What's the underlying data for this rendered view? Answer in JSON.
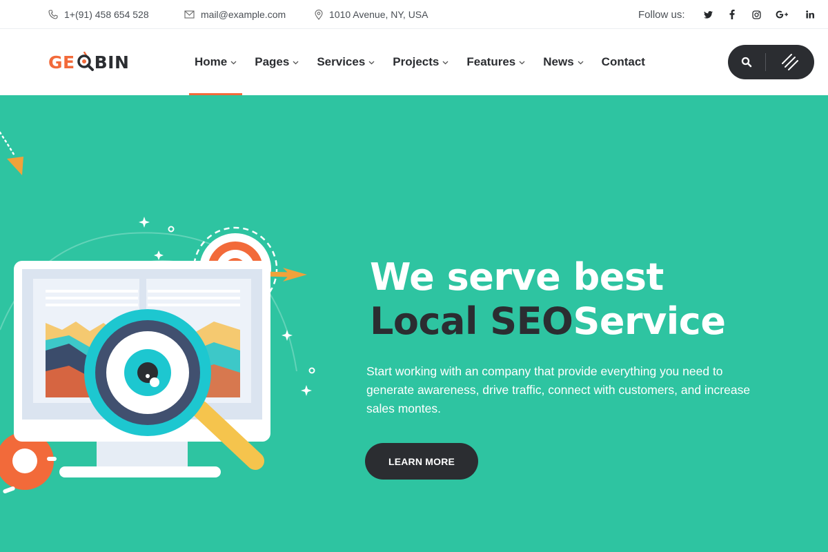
{
  "topbar": {
    "phone": "1+(91) 458 654 528",
    "email": "mail@example.com",
    "address": "1010 Avenue, NY, USA",
    "follow_label": "Follow us:",
    "social": [
      {
        "icon": "twitter-icon",
        "glyph": "t"
      },
      {
        "icon": "facebook-icon",
        "glyph": "f"
      },
      {
        "icon": "instagram-icon",
        "glyph": "o"
      },
      {
        "icon": "google-plus-icon",
        "glyph": "G+"
      },
      {
        "icon": "linkedin-icon",
        "glyph": "in"
      }
    ]
  },
  "header": {
    "logo": {
      "part1": "GE",
      "part2": "BIN"
    },
    "nav": [
      {
        "label": "Home",
        "has_dropdown": true,
        "active": true
      },
      {
        "label": "Pages",
        "has_dropdown": true
      },
      {
        "label": "Services",
        "has_dropdown": true
      },
      {
        "label": "Projects",
        "has_dropdown": true
      },
      {
        "label": "Features",
        "has_dropdown": true
      },
      {
        "label": "News",
        "has_dropdown": true
      },
      {
        "label": "Contact",
        "has_dropdown": false
      }
    ],
    "actions": {
      "search_icon": "search-icon",
      "menu_icon": "menu-lines-icon"
    }
  },
  "hero": {
    "title_line1": "We serve best",
    "title_line2_dark": "Local SEO",
    "title_line2_light": "Service",
    "description": "Start working with an company that provide everything you need to generate awareness, drive traffic, connect with customers, and increase sales montes.",
    "cta_label": "LEARN MORE"
  },
  "colors": {
    "brand_orange": "#f26a3a",
    "hero_bg": "#2ec4a1",
    "dark": "#2b2d31"
  }
}
